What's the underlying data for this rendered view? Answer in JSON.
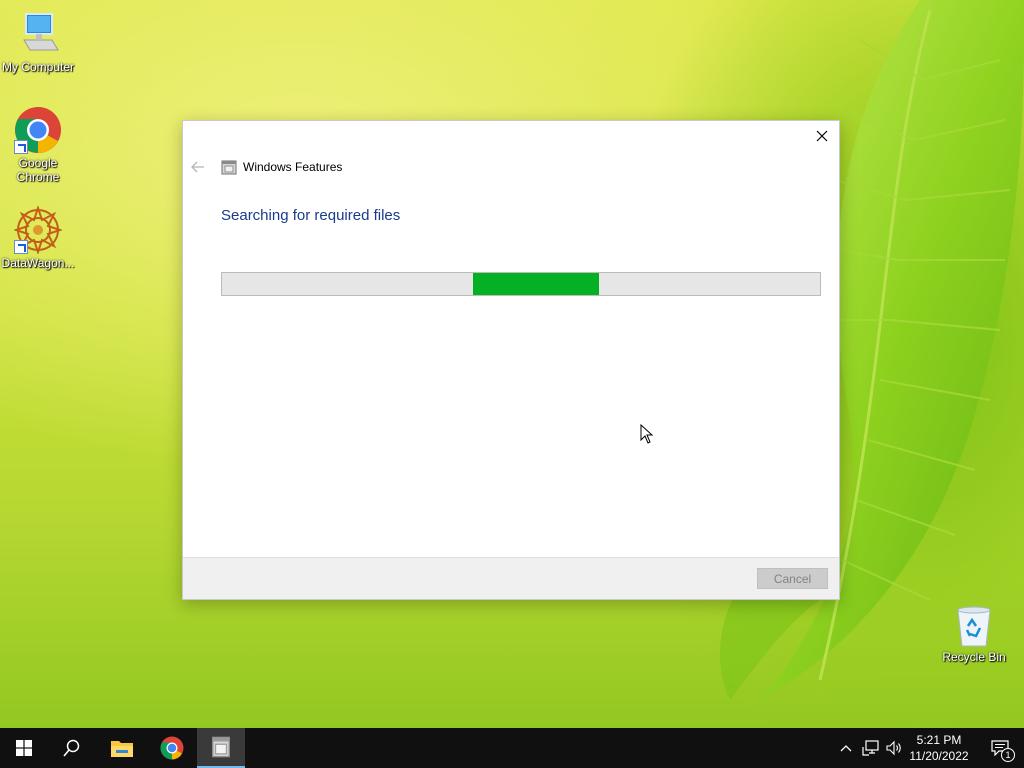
{
  "desktop": {
    "icons": [
      {
        "label": "My Computer",
        "icon": "computer-icon"
      },
      {
        "label": "Google Chrome",
        "icon": "chrome-icon"
      },
      {
        "label": "DataWagon...",
        "icon": "datawagon-icon"
      },
      {
        "label": "Recycle Bin",
        "icon": "recycle-bin-icon"
      }
    ]
  },
  "dialog": {
    "title": "Windows Features",
    "heading": "Searching for required files",
    "progress": {
      "fill_start": 0.42,
      "fill_end": 0.63,
      "color": "#06b025"
    },
    "cancel_label": "Cancel",
    "cancel_enabled": false
  },
  "taskbar": {
    "items": [
      "start-icon",
      "search-icon",
      "file-explorer-icon",
      "chrome-icon",
      "windows-features-icon"
    ],
    "tray": [
      "chevron-up-icon",
      "network-icon",
      "volume-icon"
    ],
    "time": "5:21 PM",
    "date": "11/20/2022",
    "notification_count": "1"
  }
}
